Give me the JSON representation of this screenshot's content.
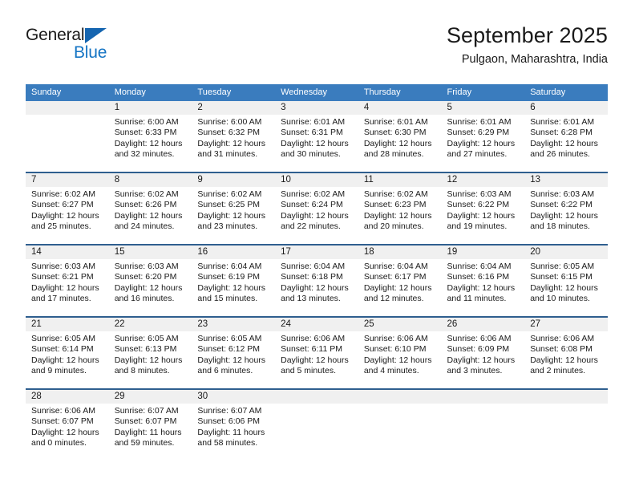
{
  "logo": {
    "line1": "General",
    "line2": "Blue",
    "triangle_color": "#1565b0",
    "blue_color": "#1474c4"
  },
  "header": {
    "title": "September 2025",
    "subtitle": "Pulgaon, Maharashtra, India"
  },
  "theme": {
    "header_bg": "#3a7cbe",
    "header_text": "#ffffff",
    "row_divider": "#2f5f8f",
    "daynum_bg": "#f0f0f0",
    "body_text": "#1a1a1a"
  },
  "calendar": {
    "weekday_headers": [
      "Sunday",
      "Monday",
      "Tuesday",
      "Wednesday",
      "Thursday",
      "Friday",
      "Saturday"
    ],
    "labels": {
      "sunrise": "Sunrise:",
      "sunset": "Sunset:",
      "daylight": "Daylight:"
    },
    "weeks": [
      [
        {
          "day": "",
          "empty": true
        },
        {
          "day": "1",
          "sunrise": "Sunrise: 6:00 AM",
          "sunset": "Sunset: 6:33 PM",
          "daylight1": "Daylight: 12 hours",
          "daylight2": "and 32 minutes."
        },
        {
          "day": "2",
          "sunrise": "Sunrise: 6:00 AM",
          "sunset": "Sunset: 6:32 PM",
          "daylight1": "Daylight: 12 hours",
          "daylight2": "and 31 minutes."
        },
        {
          "day": "3",
          "sunrise": "Sunrise: 6:01 AM",
          "sunset": "Sunset: 6:31 PM",
          "daylight1": "Daylight: 12 hours",
          "daylight2": "and 30 minutes."
        },
        {
          "day": "4",
          "sunrise": "Sunrise: 6:01 AM",
          "sunset": "Sunset: 6:30 PM",
          "daylight1": "Daylight: 12 hours",
          "daylight2": "and 28 minutes."
        },
        {
          "day": "5",
          "sunrise": "Sunrise: 6:01 AM",
          "sunset": "Sunset: 6:29 PM",
          "daylight1": "Daylight: 12 hours",
          "daylight2": "and 27 minutes."
        },
        {
          "day": "6",
          "sunrise": "Sunrise: 6:01 AM",
          "sunset": "Sunset: 6:28 PM",
          "daylight1": "Daylight: 12 hours",
          "daylight2": "and 26 minutes."
        }
      ],
      [
        {
          "day": "7",
          "sunrise": "Sunrise: 6:02 AM",
          "sunset": "Sunset: 6:27 PM",
          "daylight1": "Daylight: 12 hours",
          "daylight2": "and 25 minutes."
        },
        {
          "day": "8",
          "sunrise": "Sunrise: 6:02 AM",
          "sunset": "Sunset: 6:26 PM",
          "daylight1": "Daylight: 12 hours",
          "daylight2": "and 24 minutes."
        },
        {
          "day": "9",
          "sunrise": "Sunrise: 6:02 AM",
          "sunset": "Sunset: 6:25 PM",
          "daylight1": "Daylight: 12 hours",
          "daylight2": "and 23 minutes."
        },
        {
          "day": "10",
          "sunrise": "Sunrise: 6:02 AM",
          "sunset": "Sunset: 6:24 PM",
          "daylight1": "Daylight: 12 hours",
          "daylight2": "and 22 minutes."
        },
        {
          "day": "11",
          "sunrise": "Sunrise: 6:02 AM",
          "sunset": "Sunset: 6:23 PM",
          "daylight1": "Daylight: 12 hours",
          "daylight2": "and 20 minutes."
        },
        {
          "day": "12",
          "sunrise": "Sunrise: 6:03 AM",
          "sunset": "Sunset: 6:22 PM",
          "daylight1": "Daylight: 12 hours",
          "daylight2": "and 19 minutes."
        },
        {
          "day": "13",
          "sunrise": "Sunrise: 6:03 AM",
          "sunset": "Sunset: 6:22 PM",
          "daylight1": "Daylight: 12 hours",
          "daylight2": "and 18 minutes."
        }
      ],
      [
        {
          "day": "14",
          "sunrise": "Sunrise: 6:03 AM",
          "sunset": "Sunset: 6:21 PM",
          "daylight1": "Daylight: 12 hours",
          "daylight2": "and 17 minutes."
        },
        {
          "day": "15",
          "sunrise": "Sunrise: 6:03 AM",
          "sunset": "Sunset: 6:20 PM",
          "daylight1": "Daylight: 12 hours",
          "daylight2": "and 16 minutes."
        },
        {
          "day": "16",
          "sunrise": "Sunrise: 6:04 AM",
          "sunset": "Sunset: 6:19 PM",
          "daylight1": "Daylight: 12 hours",
          "daylight2": "and 15 minutes."
        },
        {
          "day": "17",
          "sunrise": "Sunrise: 6:04 AM",
          "sunset": "Sunset: 6:18 PM",
          "daylight1": "Daylight: 12 hours",
          "daylight2": "and 13 minutes."
        },
        {
          "day": "18",
          "sunrise": "Sunrise: 6:04 AM",
          "sunset": "Sunset: 6:17 PM",
          "daylight1": "Daylight: 12 hours",
          "daylight2": "and 12 minutes."
        },
        {
          "day": "19",
          "sunrise": "Sunrise: 6:04 AM",
          "sunset": "Sunset: 6:16 PM",
          "daylight1": "Daylight: 12 hours",
          "daylight2": "and 11 minutes."
        },
        {
          "day": "20",
          "sunrise": "Sunrise: 6:05 AM",
          "sunset": "Sunset: 6:15 PM",
          "daylight1": "Daylight: 12 hours",
          "daylight2": "and 10 minutes."
        }
      ],
      [
        {
          "day": "21",
          "sunrise": "Sunrise: 6:05 AM",
          "sunset": "Sunset: 6:14 PM",
          "daylight1": "Daylight: 12 hours",
          "daylight2": "and 9 minutes."
        },
        {
          "day": "22",
          "sunrise": "Sunrise: 6:05 AM",
          "sunset": "Sunset: 6:13 PM",
          "daylight1": "Daylight: 12 hours",
          "daylight2": "and 8 minutes."
        },
        {
          "day": "23",
          "sunrise": "Sunrise: 6:05 AM",
          "sunset": "Sunset: 6:12 PM",
          "daylight1": "Daylight: 12 hours",
          "daylight2": "and 6 minutes."
        },
        {
          "day": "24",
          "sunrise": "Sunrise: 6:06 AM",
          "sunset": "Sunset: 6:11 PM",
          "daylight1": "Daylight: 12 hours",
          "daylight2": "and 5 minutes."
        },
        {
          "day": "25",
          "sunrise": "Sunrise: 6:06 AM",
          "sunset": "Sunset: 6:10 PM",
          "daylight1": "Daylight: 12 hours",
          "daylight2": "and 4 minutes."
        },
        {
          "day": "26",
          "sunrise": "Sunrise: 6:06 AM",
          "sunset": "Sunset: 6:09 PM",
          "daylight1": "Daylight: 12 hours",
          "daylight2": "and 3 minutes."
        },
        {
          "day": "27",
          "sunrise": "Sunrise: 6:06 AM",
          "sunset": "Sunset: 6:08 PM",
          "daylight1": "Daylight: 12 hours",
          "daylight2": "and 2 minutes."
        }
      ],
      [
        {
          "day": "28",
          "sunrise": "Sunrise: 6:06 AM",
          "sunset": "Sunset: 6:07 PM",
          "daylight1": "Daylight: 12 hours",
          "daylight2": "and 0 minutes."
        },
        {
          "day": "29",
          "sunrise": "Sunrise: 6:07 AM",
          "sunset": "Sunset: 6:07 PM",
          "daylight1": "Daylight: 11 hours",
          "daylight2": "and 59 minutes."
        },
        {
          "day": "30",
          "sunrise": "Sunrise: 6:07 AM",
          "sunset": "Sunset: 6:06 PM",
          "daylight1": "Daylight: 11 hours",
          "daylight2": "and 58 minutes."
        },
        {
          "day": "",
          "empty": true
        },
        {
          "day": "",
          "empty": true
        },
        {
          "day": "",
          "empty": true
        },
        {
          "day": "",
          "empty": true
        }
      ]
    ]
  }
}
